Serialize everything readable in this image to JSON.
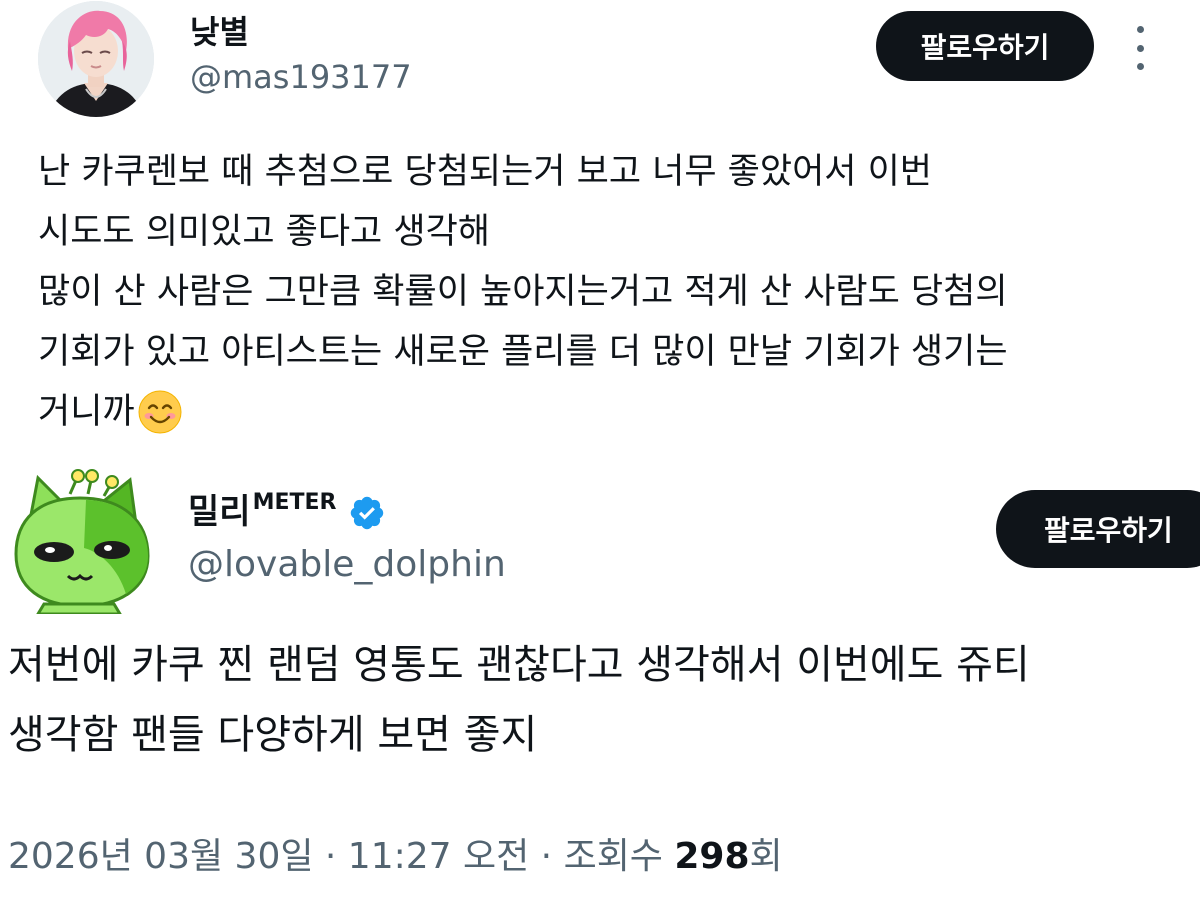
{
  "tweet1": {
    "display_name": "낮별",
    "handle": "@mas193177",
    "follow_label": "팔로우하기",
    "body_lines": [
      "난 카쿠렌보 때 추첨으로 당첨되는거 보고 너무 좋았어서 이번",
      "시도도 의미있고 좋다고 생각해",
      "많이 산 사람은 그만큼 확률이 높아지는거고 적게 산 사람도 당첨의",
      "기회가 있고 아티스트는 새로운 플리를 더 많이 만날 기회가 생기는",
      "거니까"
    ],
    "trailing_emoji": "smiling-face-icon"
  },
  "tweet2": {
    "display_name": "밀리",
    "display_name_sup": "METER",
    "verified": true,
    "handle": "@lovable_dolphin",
    "follow_label": "팔로우하기",
    "body_lines": [
      "저번에 카쿠 찐 랜덤 영통도 괜찮다고 생각해서 이번에도 쥬티",
      "생각함 팬들 다양하게 보면 좋지"
    ],
    "meta": {
      "date_time": "2026년 03월 30일 · 11:27 오전 · 조회수 ",
      "views": "298",
      "views_suffix": "회"
    }
  },
  "colors": {
    "text": "#0f1419",
    "secondary": "#536471",
    "button_bg": "#0f1419",
    "verified": "#1d9bf0"
  }
}
